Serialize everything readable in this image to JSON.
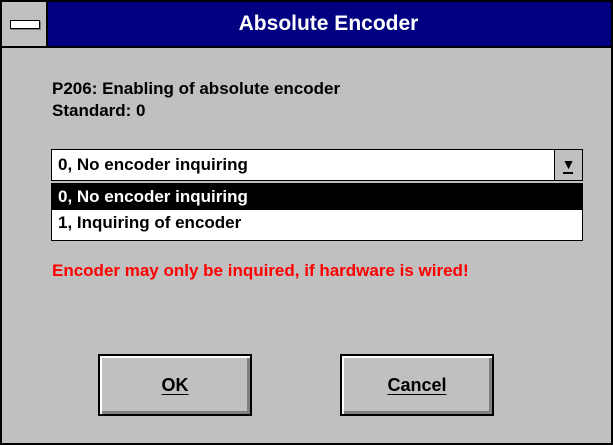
{
  "window": {
    "title": "Absolute Encoder"
  },
  "param": {
    "line1": "P206: Enabling of absolute encoder",
    "line2": "Standard: 0"
  },
  "combo": {
    "value": "0, No encoder inquiring"
  },
  "options": [
    "0, No encoder inquiring",
    "1, Inquiring of encoder"
  ],
  "warning": "Encoder may only be inquired, if hardware is wired!",
  "buttons": {
    "ok": "OK",
    "cancel": "Cancel"
  },
  "colors": {
    "titlebar": "#000080",
    "warning": "#ff0000",
    "face": "#c0c0c0"
  },
  "icons": {
    "system_menu": "system-menu-icon",
    "dropdown": "dropdown-arrow-icon"
  }
}
